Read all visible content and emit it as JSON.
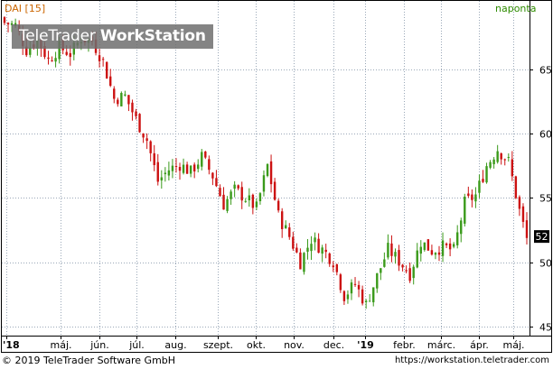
{
  "header": {
    "symbol": "DAI [15]",
    "period": "naponta"
  },
  "watermark": {
    "brand": "TeleTrader",
    "product": "WorkStation"
  },
  "footer": {
    "copyright": "© 2019 TeleTrader Software GmbH",
    "url": "https://workstation.teletrader.com"
  },
  "colors": {
    "up": "#3a9a1a",
    "down": "#cc1111",
    "grid": "#9aa8b8",
    "axis": "#000000",
    "current_bg": "#000000"
  },
  "chart_data": {
    "type": "candlestick",
    "title": "",
    "x_tick_labels": [
      "'18",
      "máj.",
      "jún.",
      "júl.",
      "aug.",
      "szept.",
      "okt.",
      "nov.",
      "dec.",
      "'19",
      "febr.",
      "márc.",
      "ápr.",
      "máj."
    ],
    "y_ticks": [
      45,
      50,
      55,
      60,
      65
    ],
    "ylim": [
      44.3,
      70.3
    ],
    "current_value": "52",
    "grid": true,
    "close_path": [
      [
        0,
        68.6
      ],
      [
        3,
        68.4
      ],
      [
        6,
        66.5
      ],
      [
        9,
        67.3
      ],
      [
        12,
        65.7
      ],
      [
        15,
        66.7
      ],
      [
        18,
        66.2
      ],
      [
        21,
        67.4
      ],
      [
        24,
        67.2
      ],
      [
        27,
        65.6
      ],
      [
        30,
        62.7
      ],
      [
        33,
        62.9
      ],
      [
        36,
        61.1
      ],
      [
        39,
        59.5
      ],
      [
        42,
        56.3
      ],
      [
        45,
        57.2
      ],
      [
        48,
        57.6
      ],
      [
        51,
        57.0
      ],
      [
        54,
        58.2
      ],
      [
        57,
        56.7
      ],
      [
        60,
        54.5
      ],
      [
        63,
        55.6
      ],
      [
        66,
        55.0
      ],
      [
        69,
        54.2
      ],
      [
        72,
        57.5
      ],
      [
        75,
        53.6
      ],
      [
        78,
        52.0
      ],
      [
        81,
        50.0
      ],
      [
        84,
        51.8
      ],
      [
        87,
        51.0
      ],
      [
        90,
        50.1
      ],
      [
        93,
        47.4
      ],
      [
        96,
        48.3
      ],
      [
        99,
        46.7
      ],
      [
        102,
        48.9
      ],
      [
        105,
        51.0
      ],
      [
        108,
        50.1
      ],
      [
        111,
        49.1
      ],
      [
        114,
        51.6
      ],
      [
        117,
        50.9
      ],
      [
        120,
        51.2
      ],
      [
        123,
        50.9
      ],
      [
        126,
        54.6
      ],
      [
        129,
        55.2
      ],
      [
        132,
        57.5
      ],
      [
        135,
        58.8
      ],
      [
        138,
        57.8
      ],
      [
        141,
        54.0
      ],
      [
        143,
        51.8
      ]
    ]
  }
}
